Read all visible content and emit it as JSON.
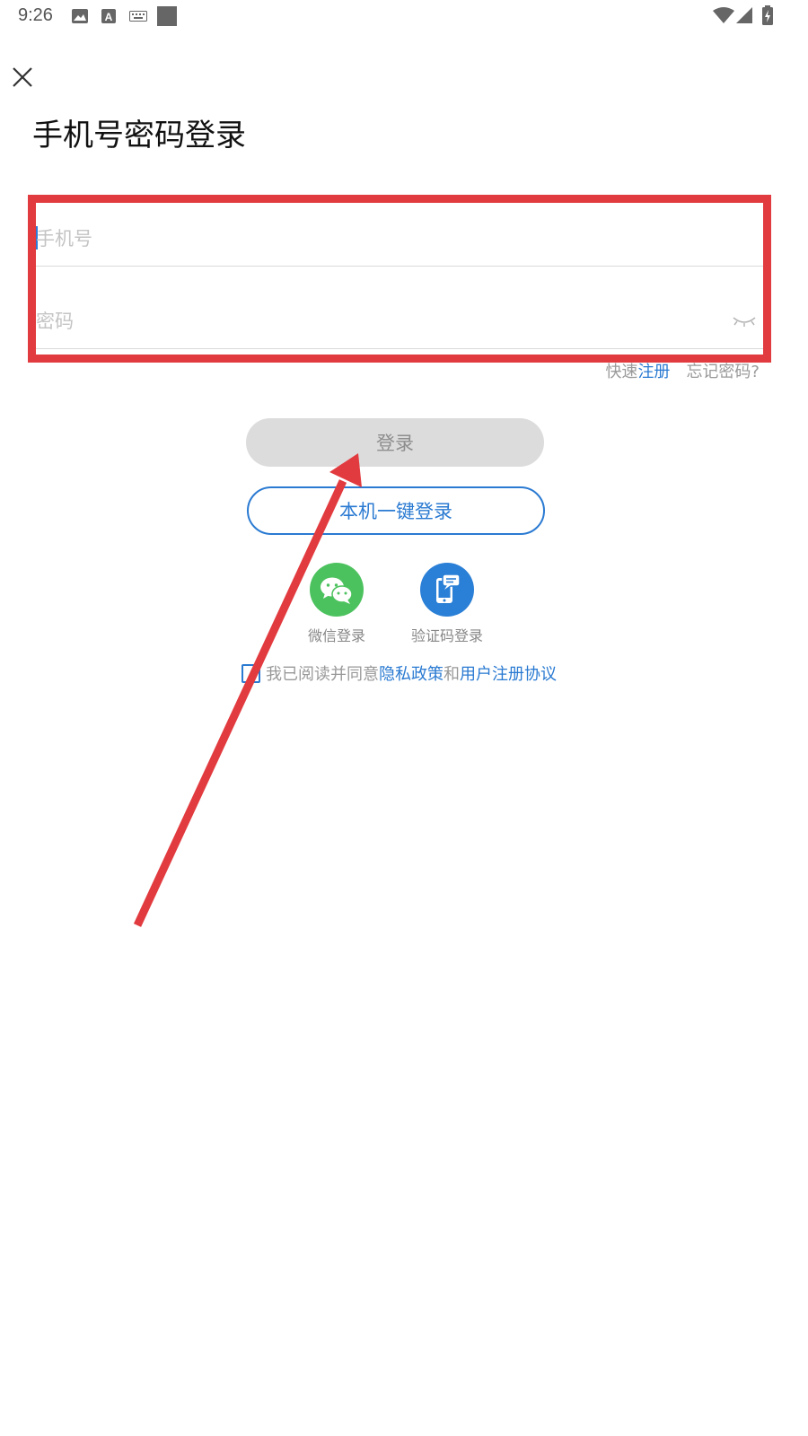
{
  "status_bar": {
    "time": "9:26",
    "icons": [
      "image-icon",
      "text-a-icon",
      "keyboard-icon",
      "square-icon",
      "wifi-icon",
      "signal-icon",
      "battery-icon"
    ]
  },
  "header": {
    "close_icon": "close-icon",
    "title": "手机号密码登录"
  },
  "form": {
    "phone_placeholder": "手机号",
    "password_placeholder": "密码",
    "password_toggle_icon": "eye-closed-icon"
  },
  "aux_links": {
    "quick_prefix": "快速",
    "register": "注册",
    "forgot": "忘记密码?"
  },
  "buttons": {
    "login": "登录",
    "one_key_login": "本机一键登录"
  },
  "social": [
    {
      "label": "微信登录",
      "icon": "wechat-icon",
      "color": "#4cc25e"
    },
    {
      "label": "验证码登录",
      "icon": "phone-sms-icon",
      "color": "#2a7fd6"
    }
  ],
  "agreement": {
    "prefix": "我已阅读并同意",
    "privacy": "隐私政策",
    "and": "和",
    "terms": "用户注册协议",
    "checked": false
  },
  "colors": {
    "accent": "#2a7ad2",
    "annotation": "#e23b3f",
    "disabled_button": "#dcdcdc"
  }
}
